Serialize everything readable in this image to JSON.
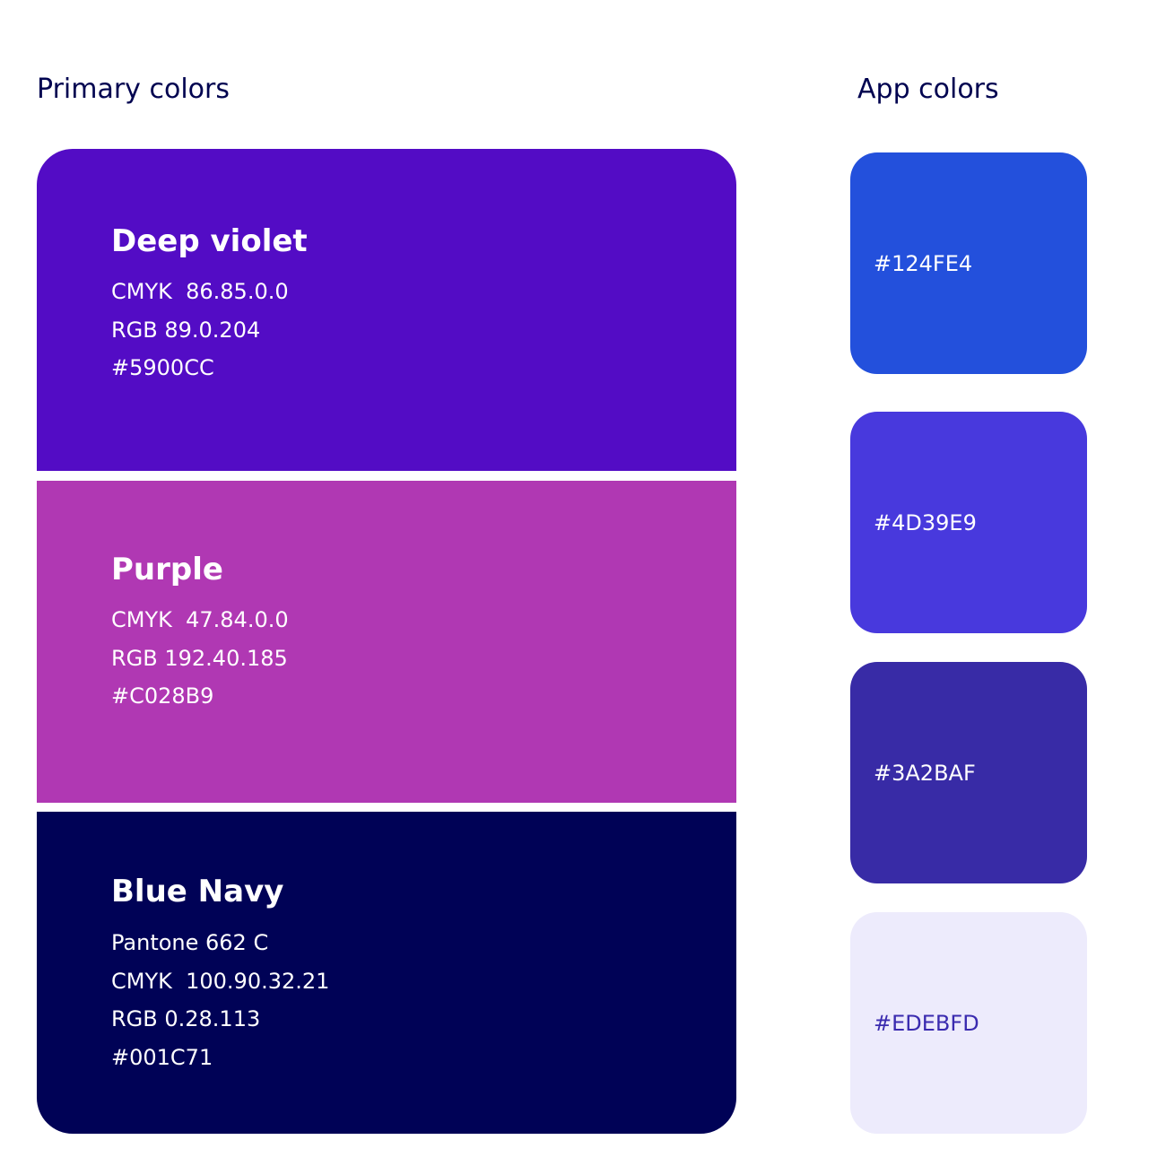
{
  "headings": {
    "primary": "Primary colors",
    "app": "App colors"
  },
  "primary_colors": [
    {
      "name": "Deep violet",
      "specs": [
        "CMYK  86.85.0.0",
        "RGB 89.0.204",
        "#5900CC"
      ],
      "swatch": "#530CC5"
    },
    {
      "name": "Purple",
      "specs": [
        "CMYK  47.84.0.0",
        "RGB 192.40.185",
        "#C028B9"
      ],
      "swatch": "#B038B3"
    },
    {
      "name": "Blue Navy",
      "specs": [
        "Pantone 662 C",
        "CMYK  100.90.32.21",
        "RGB 0.28.113",
        "#001C71"
      ],
      "swatch": "#000256"
    }
  ],
  "app_colors": [
    {
      "hex": "#124FE4",
      "swatch": "#2350DC",
      "text_color": "#ffffff"
    },
    {
      "hex": "#4D39E9",
      "swatch": "#4839DD",
      "text_color": "#ffffff"
    },
    {
      "hex": "#3A2BAF",
      "swatch": "#382BA6",
      "text_color": "#ffffff"
    },
    {
      "hex": "#EDEBFD",
      "swatch": "#EDEBFC",
      "text_color": "#3A2BAF"
    }
  ]
}
